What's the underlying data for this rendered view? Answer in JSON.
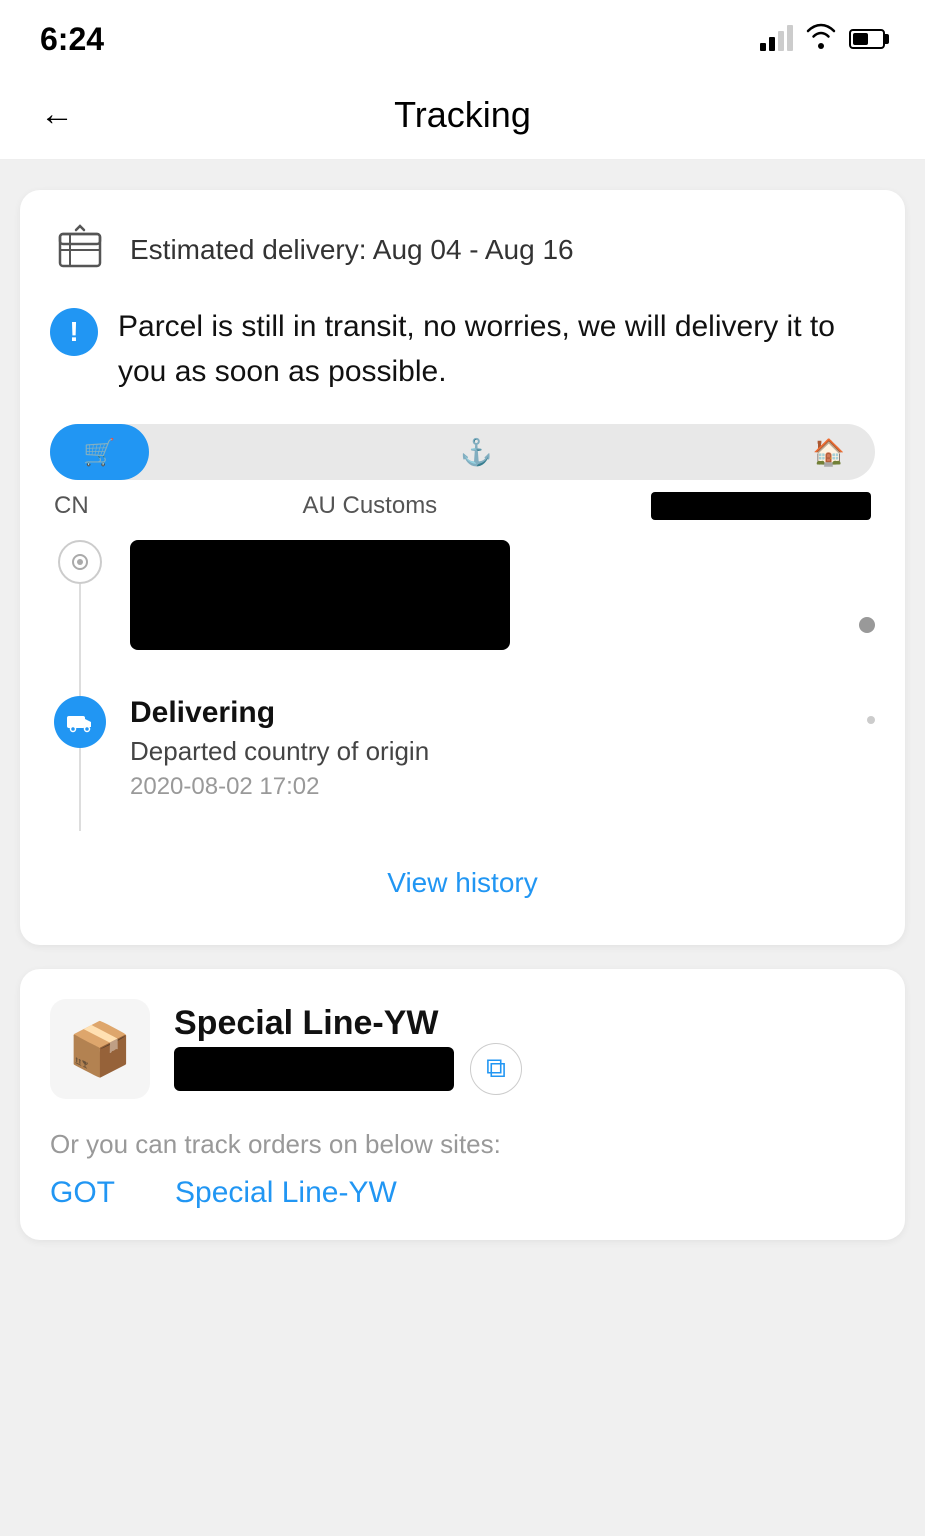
{
  "statusBar": {
    "time": "6:24"
  },
  "nav": {
    "title": "Tracking",
    "backLabel": "←"
  },
  "trackingCard": {
    "estimatedDelivery": "Estimated delivery: Aug 04 - Aug 16",
    "alertText": "Parcel is still in transit, no worries, we will delivery it to you as soon as possible.",
    "progressLabels": {
      "cn": "CN",
      "customs": "AU Customs"
    },
    "events": [
      {
        "type": "redacted",
        "hasImage": true
      },
      {
        "type": "normal",
        "title": "Delivering",
        "subtitle": "Departed country of origin",
        "time": "2020-08-02 17:02"
      }
    ],
    "viewHistoryLabel": "View history"
  },
  "specialLineCard": {
    "shippingMethod": "Special Line-YW",
    "orTrackText": "Or you can track orders on below sites:",
    "trackLinks": [
      {
        "label": "GOT"
      },
      {
        "label": "Special Line-YW"
      }
    ],
    "copyIconLabel": "⧉"
  }
}
